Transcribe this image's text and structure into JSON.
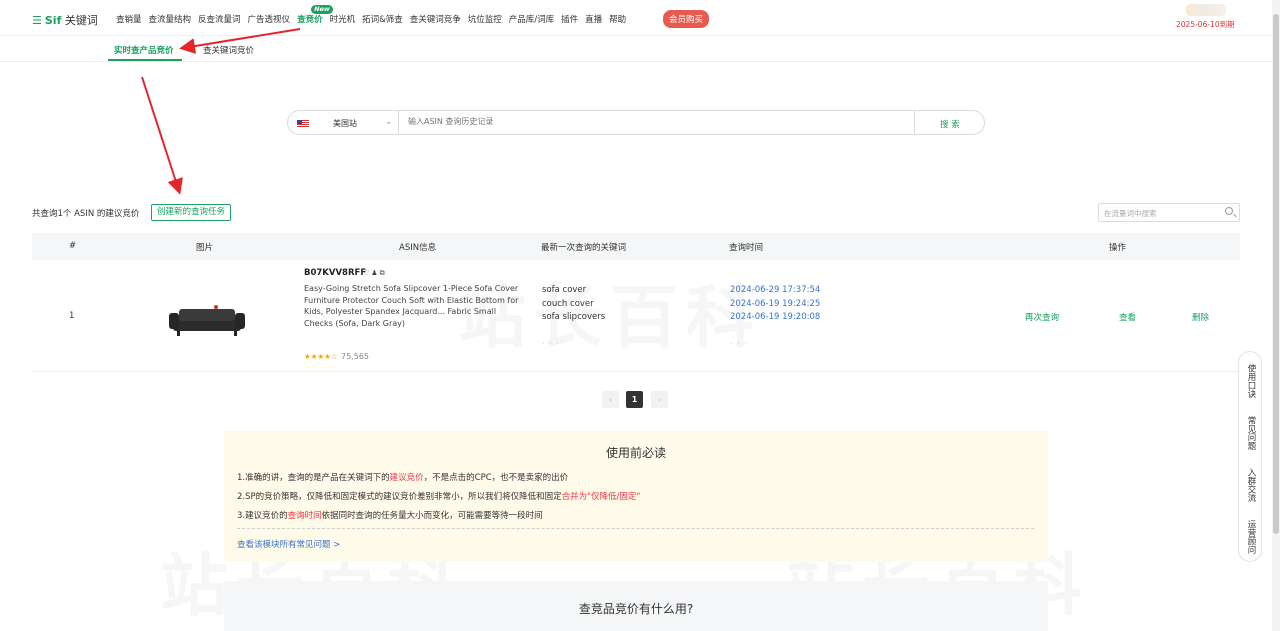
{
  "nav": {
    "logo_name": "Sif",
    "logo_sub": "关键词",
    "items": [
      "查销量",
      "查流量结构",
      "反查流量词",
      "广告透视仪",
      "查竞价",
      "时光机",
      "拓词&筛查",
      "查关键词竞争",
      "坑位监控",
      "产品库/词库",
      "插件",
      "直播",
      "帮助"
    ],
    "new_badge": "New",
    "vip_button": "会员购买",
    "expire_text": "2025-06-10到期"
  },
  "subtabs": [
    "实时查产品竞价",
    "查关键词竞价"
  ],
  "search": {
    "site": "美国站",
    "placeholder": "输入ASIN 查询历史记录",
    "button": "搜 索"
  },
  "result": {
    "count_text": "共查询1个 ASIN 的建议竞价",
    "create_button": "创建新的查询任务",
    "keyword_search_placeholder": "在流量词中搜索"
  },
  "table": {
    "headers": [
      "#",
      "图片",
      "ASIN信息",
      "最新一次查询的关键词",
      "查询时间",
      "操作"
    ],
    "rows": [
      {
        "index": "1",
        "asin": "B07KVV8RFF",
        "title": "Easy-Going Stretch Sofa Slipcover 1-Piece Sofa Cover Furniture Protector Couch Soft with Elastic Bottom for Kids, Polyester Spandex Jacquard... Fabric Small Checks (Sofa, Dark Gray)",
        "stars": "★★★★☆",
        "rating_count": "75,565",
        "keywords": [
          "sofa cover",
          "couch cover",
          "sofa slipcovers"
        ],
        "times": [
          "2024-06-29 17:37:54",
          "2024-06-19 19:24:25",
          "2024-06-19 19:20:08"
        ],
        "actions": [
          "再次查询",
          "查看",
          "删除"
        ]
      }
    ]
  },
  "pagination": {
    "prev": "‹",
    "current": "1",
    "next": "›"
  },
  "notice": {
    "title": "使用前必读",
    "line1_a": "1.准确的讲，查询的是产品在关键词下的",
    "line1_red": "建议竞价",
    "line1_b": "，不是点击的CPC，也不是卖家的出价",
    "line2_a": "2.SP的竞价策略，仅降低和固定模式的建议竞价差别非常小，所以我们将仅降低和固定",
    "line2_red": "合并为\"仅降低/固定\"",
    "line3_a": "3.建议竞价的",
    "line3_red": "查询时间",
    "line3_b": "依据同时查询的任务量大小而变化，可能需要等待一段时间",
    "link": "查看该模块所有常见问题 >"
  },
  "faq_title": "查竞品竞价有什么用?",
  "side_panel": [
    "使用口诀",
    "常见问题",
    "入群交流",
    "运营顾问"
  ],
  "watermark": "站长百科"
}
